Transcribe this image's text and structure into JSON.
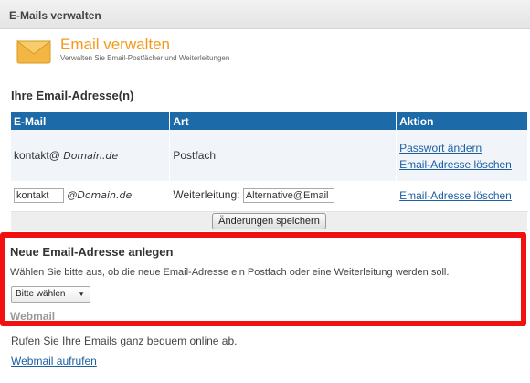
{
  "header": {
    "title": "E-Mails verwalten"
  },
  "intro": {
    "icon": "envelope-icon",
    "title": "Email verwalten",
    "subtitle": "Verwalten Sie Email-Postfächer und Weiterleitungen"
  },
  "addresses": {
    "title": "Ihre Email-Adresse(n)",
    "columns": [
      "E-Mail",
      "Art",
      "Aktion"
    ],
    "row1": {
      "local": "kontakt@",
      "domain": "Domain.de",
      "type": "Postfach",
      "action1": "Passwort ändern",
      "action2": "Email-Adresse löschen"
    },
    "row2": {
      "local_value": "kontakt",
      "domain": "@Domain.de",
      "type_label": "Weiterleitung:",
      "forward_value": "Alternative@Email",
      "action": "Email-Adresse löschen"
    },
    "save_label": "Änderungen speichern"
  },
  "new_address": {
    "title": "Neue Email-Adresse anlegen",
    "description": "Wählen Sie bitte aus, ob die neue Email-Adresse ein Postfach oder eine Weiterleitung werden soll.",
    "select_value": "Bitte wählen",
    "partial_text": "Webmail"
  },
  "webmail": {
    "text": "Rufen Sie Ihre Emails ganz bequem online ab.",
    "link": "Webmail aufrufen"
  },
  "accent_colors": {
    "header_blue": "#1d6aa8",
    "title_orange": "#f39a1b",
    "highlight_red": "#f20f0f"
  }
}
